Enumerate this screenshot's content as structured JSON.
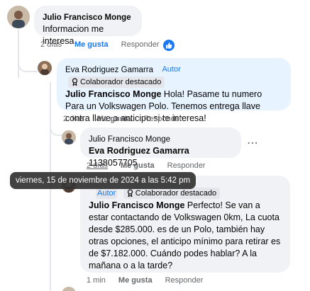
{
  "comments": [
    {
      "author": "Julio Francisco Monge",
      "text": "Informacion me interesa",
      "time": "2 días",
      "like": "Me gusta",
      "reply": "Responder",
      "reaction_icon": "thumbs-up-icon",
      "liked": true
    },
    {
      "author": "Eva Rodriguez Gamarra",
      "author_badge": "Autor",
      "contributor_badge": "Colaborador destacado",
      "mention": "Julio Francisco Monge",
      "text": " Hola! Pasame tu numero Para un Volkswagen Polo. Tenemos entrega llave contra llave o anticipo si te interesa!",
      "time": "2 días",
      "like": "Me gusta",
      "reply": "Responder"
    },
    {
      "author": "Julio Francisco Monge",
      "mention": "Eva Rodriguez Gamarra",
      "text": " 1138057705",
      "time": "2 días",
      "like": "Me gusta",
      "reply": "Responder",
      "more_icon": "more-options-icon"
    },
    {
      "author_badge": "Autor",
      "contributor_badge": "Colaborador destacado",
      "mention": "Julio Francisco Monge",
      "text": " Perfecto! Se van a estar contactando de Volkswagen 0km, La cuota desde $285.000. es de un Polo, también hay otras opciones, el anticipo mínimo para retirar es de $7.182.000. Cuándo podes hablar? A la mañana o a la tarde?",
      "time": "1 min",
      "like": "Me gusta",
      "reply": "Responder"
    }
  ],
  "tooltip": "viernes, 15 de noviembre de 2024 a las 5:42 pm",
  "colors": {
    "accent": "#1877f2",
    "bubble_gray": "#f0f2f5",
    "bubble_blue": "#e7f3ff",
    "muted_text": "#65676b"
  }
}
